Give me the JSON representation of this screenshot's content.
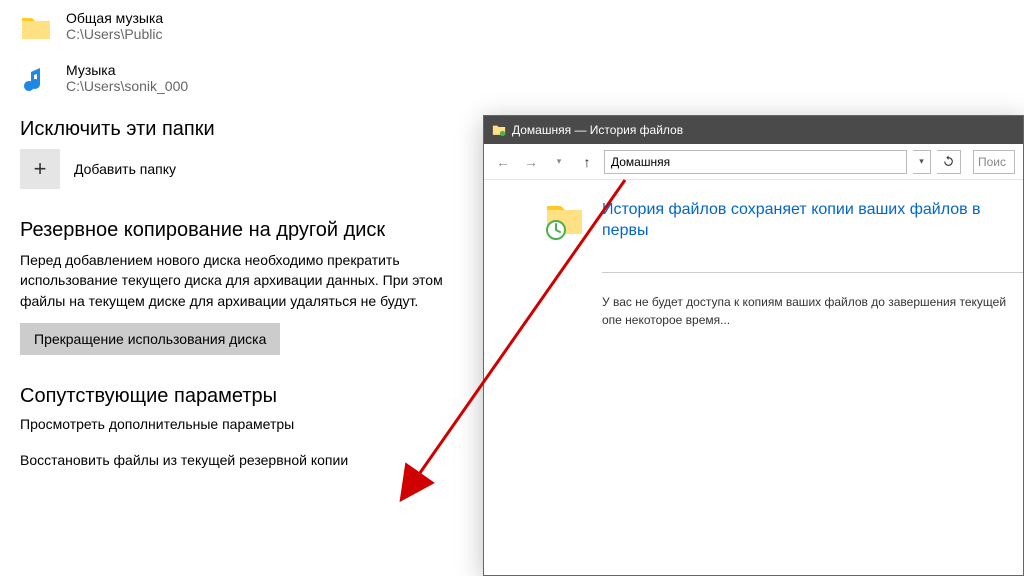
{
  "folders": [
    {
      "name": "Общая музыка",
      "path": "C:\\Users\\Public"
    },
    {
      "name": "Музыка",
      "path": "C:\\Users\\sonik_000"
    }
  ],
  "exclude": {
    "title": "Исключить эти папки",
    "add_label": "Добавить папку"
  },
  "backup_disk": {
    "title": "Резервное копирование на другой диск",
    "text": "Перед добавлением нового диска необходимо прекратить использование текущего диска для архивации данных. При этом файлы на текущем диске для архивации удаляться не будут.",
    "button": "Прекращение использования диска"
  },
  "related": {
    "title": "Сопутствующие параметры",
    "link1": "Просмотреть дополнительные параметры",
    "link2": "Восстановить файлы из текущей резервной копии"
  },
  "fh": {
    "window_title": "Домашняя — История файлов",
    "address": "Домашняя",
    "search_placeholder": "Поис",
    "heading": "История файлов сохраняет копии ваших файлов в первы",
    "body": "У вас не будет доступа к копиям ваших файлов до завершения текущей опе некоторое время..."
  }
}
